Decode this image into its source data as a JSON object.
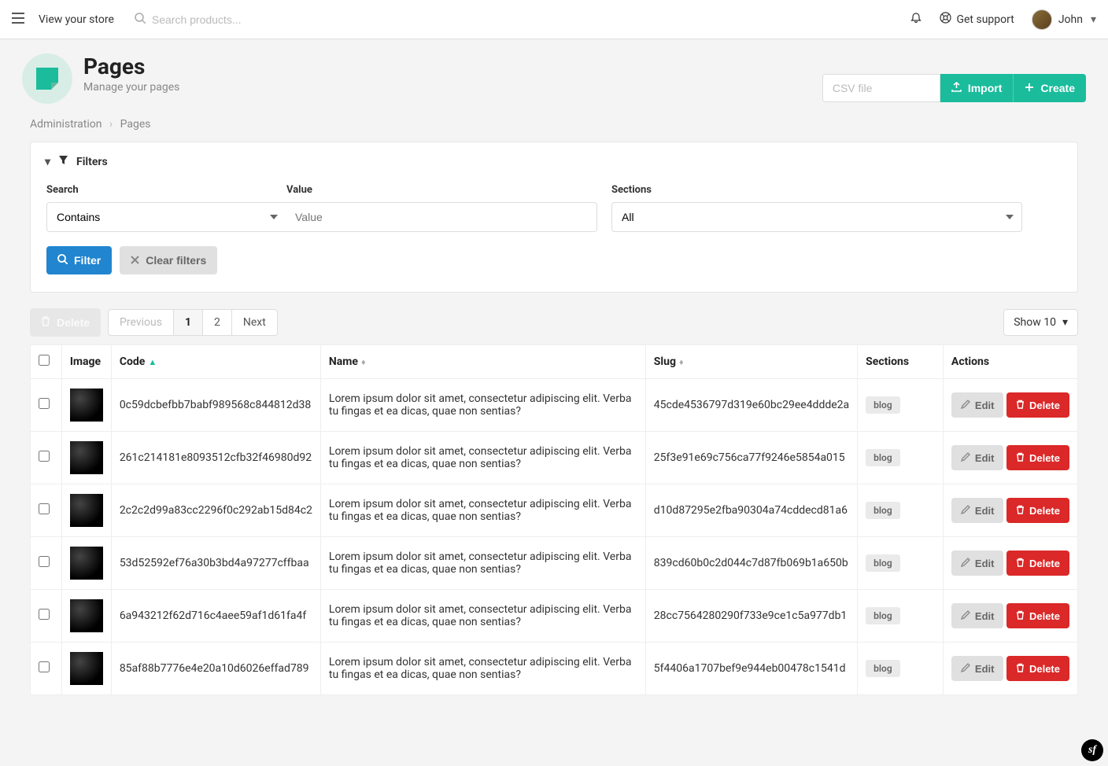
{
  "topbar": {
    "view_store": "View your store",
    "search_placeholder": "Search products...",
    "support": "Get support",
    "user_name": "John"
  },
  "header": {
    "title": "Pages",
    "subtitle": "Manage your pages",
    "csv_placeholder": "CSV file",
    "import": "Import",
    "create": "Create"
  },
  "breadcrumb": {
    "admin": "Administration",
    "current": "Pages"
  },
  "filters": {
    "title": "Filters",
    "search_label": "Search",
    "search_option": "Contains",
    "value_label": "Value",
    "value_placeholder": "Value",
    "sections_label": "Sections",
    "sections_option": "All",
    "filter_btn": "Filter",
    "clear_btn": "Clear filters"
  },
  "tablebar": {
    "bulk_delete": "Delete",
    "prev": "Previous",
    "p1": "1",
    "p2": "2",
    "next": "Next",
    "show": "Show 10"
  },
  "columns": {
    "image": "Image",
    "code": "Code",
    "name": "Name",
    "slug": "Slug",
    "sections": "Sections",
    "actions": "Actions"
  },
  "actions": {
    "edit": "Edit",
    "delete": "Delete"
  },
  "rows": [
    {
      "code": "0c59dcbefbb7babf989568c844812d38",
      "name": "Lorem ipsum dolor sit amet, consectetur adipiscing elit. Verba tu fingas et ea dicas, quae non sentias?",
      "slug": "45cde4536797d319e60bc29ee4ddde2a",
      "section": "blog"
    },
    {
      "code": "261c214181e8093512cfb32f46980d92",
      "name": "Lorem ipsum dolor sit amet, consectetur adipiscing elit. Verba tu fingas et ea dicas, quae non sentias?",
      "slug": "25f3e91e69c756ca77f9246e5854a015",
      "section": "blog"
    },
    {
      "code": "2c2c2d99a83cc2296f0c292ab15d84c2",
      "name": "Lorem ipsum dolor sit amet, consectetur adipiscing elit. Verba tu fingas et ea dicas, quae non sentias?",
      "slug": "d10d87295e2fba90304a74cddecd81a6",
      "section": "blog"
    },
    {
      "code": "53d52592ef76a30b3bd4a97277cffbaa",
      "name": "Lorem ipsum dolor sit amet, consectetur adipiscing elit. Verba tu fingas et ea dicas, quae non sentias?",
      "slug": "839cd60b0c2d044c7d87fb069b1a650b",
      "section": "blog"
    },
    {
      "code": "6a943212f62d716c4aee59af1d61fa4f",
      "name": "Lorem ipsum dolor sit amet, consectetur adipiscing elit. Verba tu fingas et ea dicas, quae non sentias?",
      "slug": "28cc7564280290f733e9ce1c5a977db1",
      "section": "blog"
    },
    {
      "code": "85af88b7776e4e20a10d6026effad789",
      "name": "Lorem ipsum dolor sit amet, consectetur adipiscing elit. Verba tu fingas et ea dicas, quae non sentias?",
      "slug": "5f4406a1707bef9e944eb00478c1541d",
      "section": "blog"
    }
  ]
}
